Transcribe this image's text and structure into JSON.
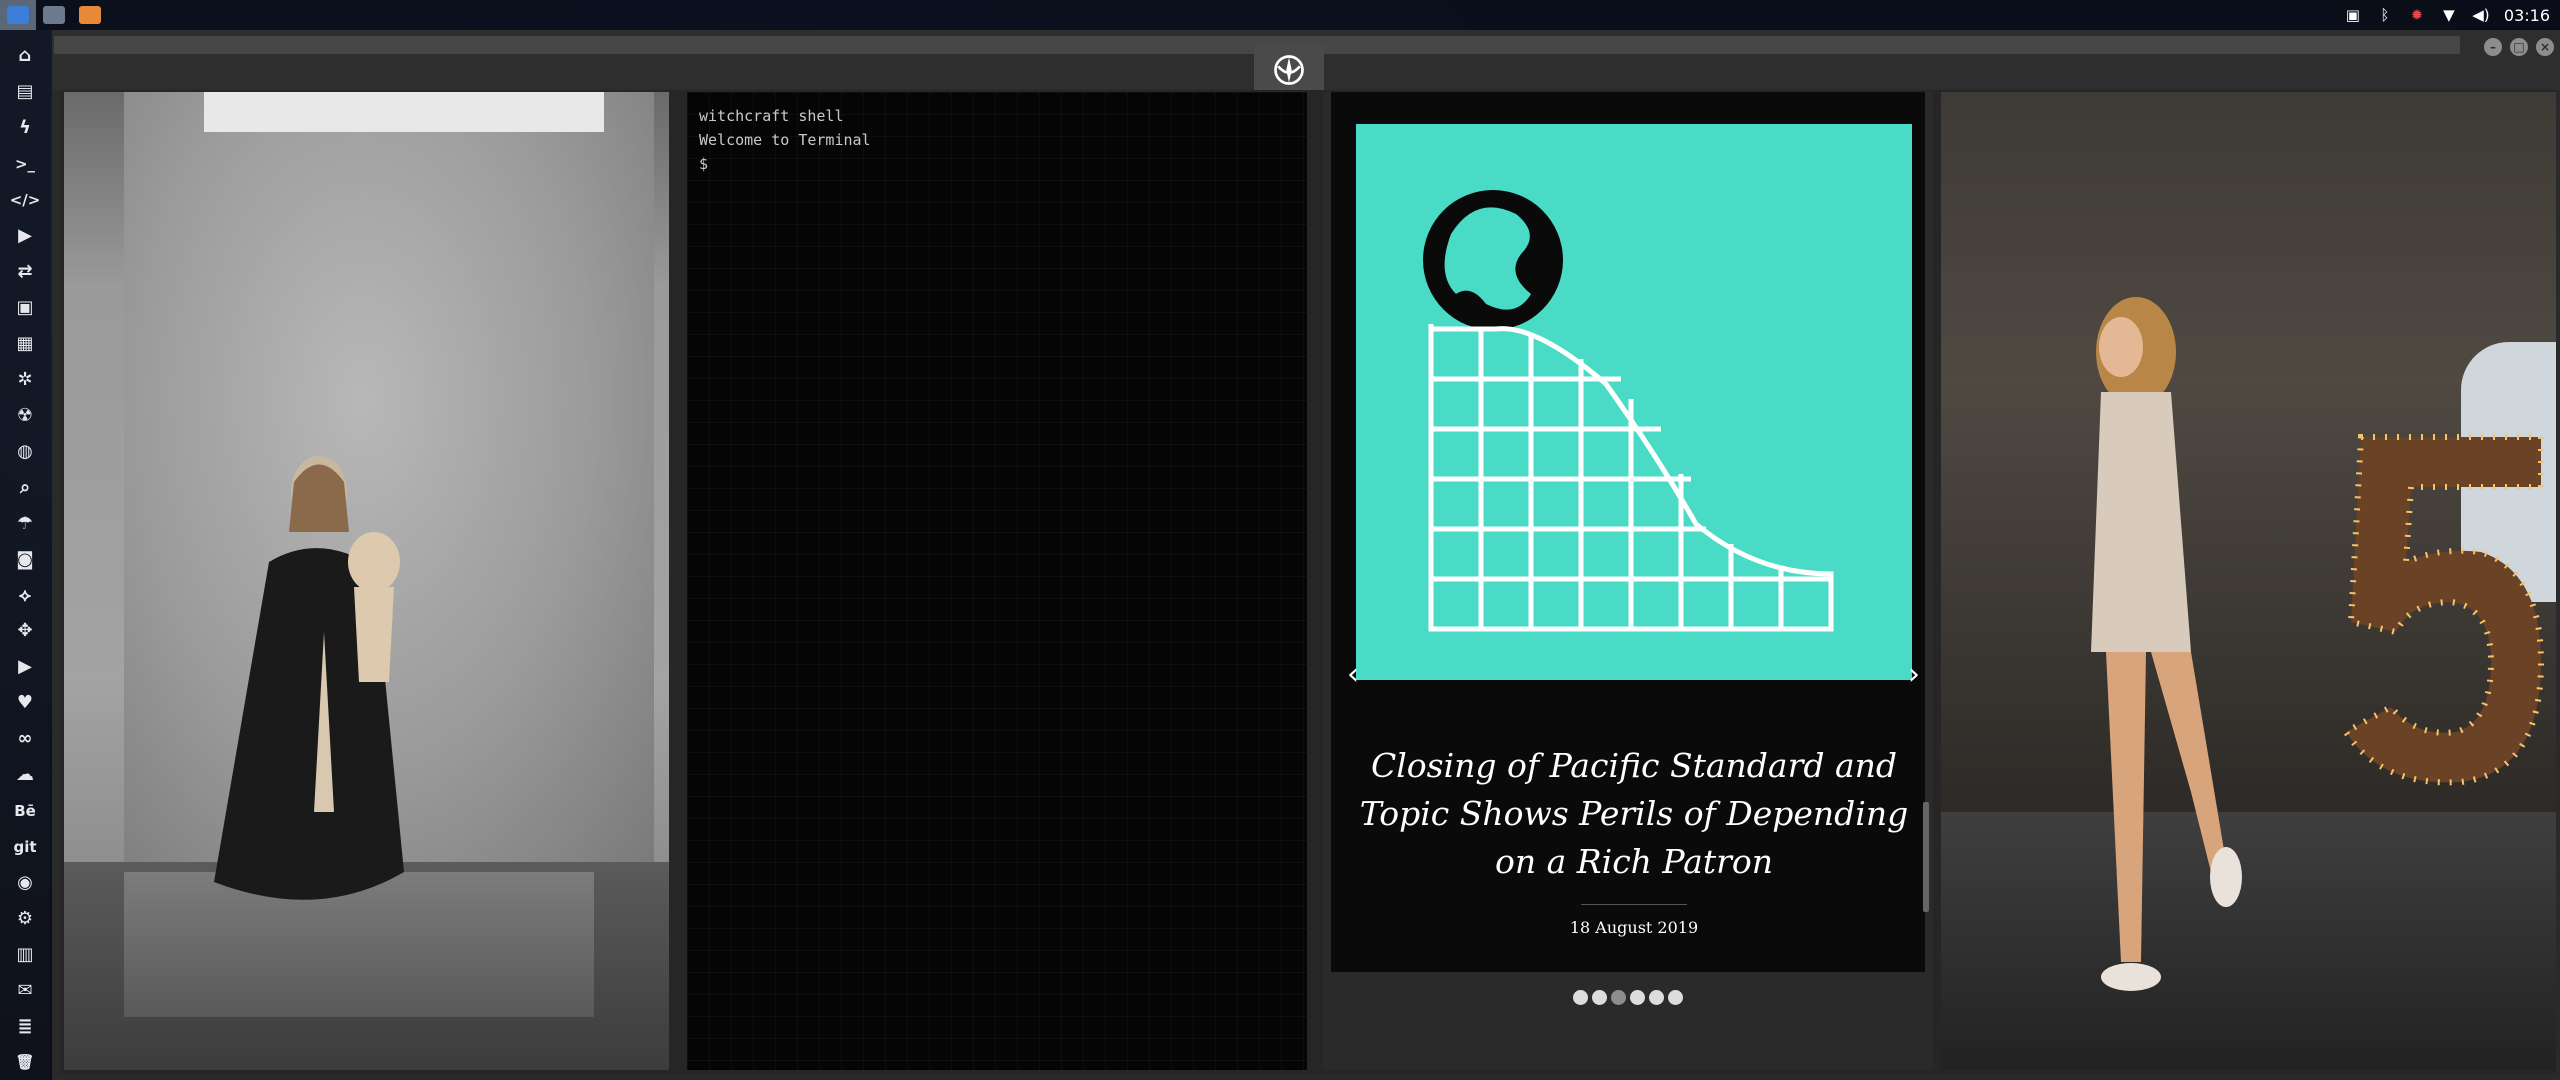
{
  "topbar": {
    "apps": [
      {
        "name": "files",
        "color": "#3a7ed8",
        "active": true
      },
      {
        "name": "image",
        "color": "#6b7a8c",
        "active": false
      },
      {
        "name": "sublime",
        "color": "#e8893a",
        "active": false
      }
    ],
    "clock": "03:16",
    "tray_icons": [
      "screenshot-icon",
      "bluetooth-icon",
      "alert-icon",
      "wifi-icon",
      "volume-icon"
    ]
  },
  "dock": {
    "items": [
      {
        "name": "home-icon",
        "glyph": "⌂"
      },
      {
        "name": "document-icon",
        "glyph": "▤"
      },
      {
        "name": "bolt-icon",
        "glyph": "ϟ"
      },
      {
        "name": "terminal-icon",
        "glyph": ">_"
      },
      {
        "name": "code-icon",
        "glyph": "</>"
      },
      {
        "name": "play-icon",
        "glyph": "▶"
      },
      {
        "name": "file-exchange-icon",
        "glyph": "⇄"
      },
      {
        "name": "image-icon",
        "glyph": "▣"
      },
      {
        "name": "newspaper-icon",
        "glyph": "▦"
      },
      {
        "name": "settings-icon",
        "glyph": "✲"
      },
      {
        "name": "radiation-icon",
        "glyph": "☢"
      },
      {
        "name": "globe-icon",
        "glyph": "◍"
      },
      {
        "name": "search-icon",
        "glyph": "⌕"
      },
      {
        "name": "umbrella-icon",
        "glyph": "☂"
      },
      {
        "name": "contact-icon",
        "glyph": "◙"
      },
      {
        "name": "handshake-icon",
        "glyph": "⟡"
      },
      {
        "name": "expand-icon",
        "glyph": "✥"
      },
      {
        "name": "youtube-icon",
        "glyph": "▶"
      },
      {
        "name": "heart-icon",
        "glyph": "♥"
      },
      {
        "name": "infinity-icon",
        "glyph": "∞"
      },
      {
        "name": "cloud-icon",
        "glyph": "☁"
      },
      {
        "name": "behance-icon",
        "glyph": "Bē"
      },
      {
        "name": "git-icon",
        "glyph": "git"
      },
      {
        "name": "github-icon",
        "glyph": "◉"
      },
      {
        "name": "cogs-icon",
        "glyph": "⚙"
      },
      {
        "name": "map-icon",
        "glyph": "▥"
      },
      {
        "name": "mail-icon",
        "glyph": "✉"
      },
      {
        "name": "server-icon",
        "glyph": "≣"
      },
      {
        "name": "trash-icon",
        "glyph": "🗑"
      }
    ]
  },
  "terminal": {
    "lines": [
      "witchcraft shell",
      "Welcome to Terminal",
      "$"
    ]
  },
  "news": {
    "title": "Closing of Pacific Standard and Topic Shows Perils of Depending on a Rich Patron",
    "date": "18 August 2019",
    "prev": "‹",
    "next": "›",
    "slide_count": 6,
    "active_index": 2,
    "image_bg": "#49dbc6"
  }
}
